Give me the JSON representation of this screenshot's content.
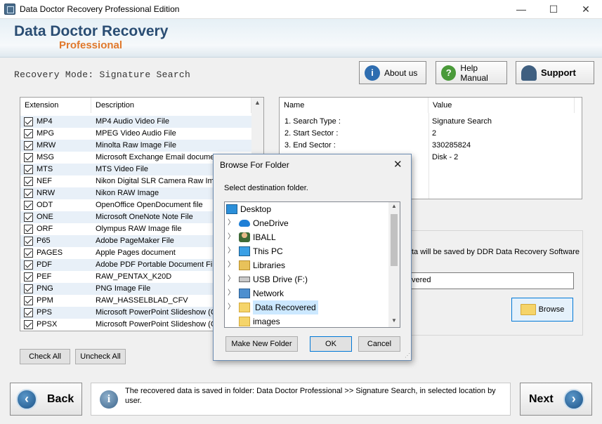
{
  "window": {
    "title": "Data Doctor Recovery Professional Edition",
    "minimize": "—",
    "maximize": "☐",
    "close": "✕"
  },
  "banner": {
    "title": "Data Doctor Recovery",
    "subtitle": "Professional"
  },
  "mode_label": "Recovery Mode: Signature Search",
  "top_buttons": {
    "about": "About us",
    "help": "Help Manual",
    "support": "Support"
  },
  "ext_list": {
    "headers": [
      "Extension",
      "Description"
    ],
    "rows": [
      {
        "ext": "MP4",
        "desc": "MP4 Audio Video File"
      },
      {
        "ext": "MPG",
        "desc": "MPEG Video Audio File"
      },
      {
        "ext": "MRW",
        "desc": "Minolta Raw Image File"
      },
      {
        "ext": "MSG",
        "desc": "Microsoft Exchange Email document"
      },
      {
        "ext": "MTS",
        "desc": "MTS Video File"
      },
      {
        "ext": "NEF",
        "desc": "Nikon Digital SLR Camera Raw Image"
      },
      {
        "ext": "NRW",
        "desc": "Nikon RAW Image"
      },
      {
        "ext": "ODT",
        "desc": "OpenOffice OpenDocument file"
      },
      {
        "ext": "ONE",
        "desc": "Microsoft OneNote Note File"
      },
      {
        "ext": "ORF",
        "desc": "Olympus RAW Image file"
      },
      {
        "ext": "P65",
        "desc": "Adobe PageMaker File"
      },
      {
        "ext": "PAGES",
        "desc": "Apple Pages document"
      },
      {
        "ext": "PDF",
        "desc": "Adobe PDF Portable Document File"
      },
      {
        "ext": "PEF",
        "desc": "RAW_PENTAX_K20D"
      },
      {
        "ext": "PNG",
        "desc": "PNG Image File"
      },
      {
        "ext": "PPM",
        "desc": "RAW_HASSELBLAD_CFV"
      },
      {
        "ext": "PPS",
        "desc": "Microsoft PowerPoint Slideshow (O"
      },
      {
        "ext": "PPSX",
        "desc": "Microsoft PowerPoint Slideshow (O"
      }
    ]
  },
  "check_all": "Check All",
  "uncheck_all": "Uncheck All",
  "info_table": {
    "headers": [
      "Name",
      "Value"
    ],
    "rows": [
      {
        "name": "1. Search Type :",
        "value": "Signature Search"
      },
      {
        "name": "2. Start Sector :",
        "value": "2"
      },
      {
        "name": "3. End Sector :",
        "value": "330285824"
      },
      {
        "name": "",
        "value": "Disk - 2"
      }
    ]
  },
  "save_info": "ta will be saved by DDR Data Recovery Software",
  "save_path": "vered",
  "browse": "Browse",
  "footer": {
    "back": "Back",
    "next": "Next",
    "info": "The recovered data is saved in folder: Data Doctor Professional  >> Signature Search, in selected location by user."
  },
  "dialog": {
    "title": "Browse For Folder",
    "prompt": "Select destination folder.",
    "tree": [
      {
        "label": "Desktop",
        "icon": "desktop-icon"
      },
      {
        "label": "OneDrive",
        "icon": "cloud-icon"
      },
      {
        "label": "IBALL",
        "icon": "user-icon"
      },
      {
        "label": "This PC",
        "icon": "computer-icon"
      },
      {
        "label": "Libraries",
        "icon": "library-icon"
      },
      {
        "label": "USB Drive (F:)",
        "icon": "usb-drive-icon"
      },
      {
        "label": "Network",
        "icon": "network-icon"
      },
      {
        "label": "Data Recovered",
        "icon": "folder-icon"
      },
      {
        "label": "images",
        "icon": "folder-icon"
      }
    ],
    "new_folder": "Make New Folder",
    "ok": "OK",
    "cancel": "Cancel"
  }
}
